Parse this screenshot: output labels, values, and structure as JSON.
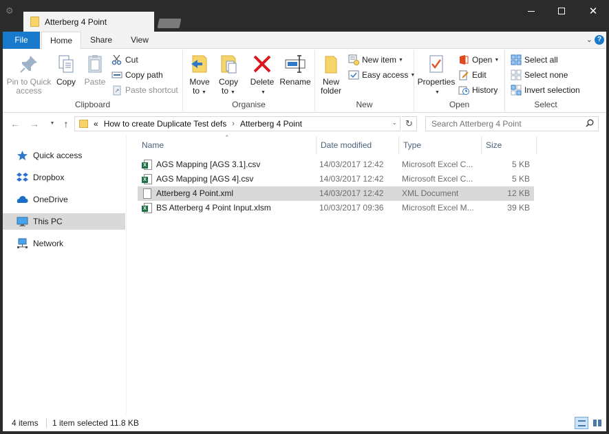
{
  "window": {
    "tab_title": "Atterberg 4 Point"
  },
  "ribbon_tabs": {
    "file": "File",
    "home": "Home",
    "share": "Share",
    "view": "View"
  },
  "ribbon": {
    "clipboard": {
      "label": "Clipboard",
      "pin_line1": "Pin to Quick",
      "pin_line2": "access",
      "copy": "Copy",
      "paste": "Paste",
      "cut": "Cut",
      "copy_path": "Copy path",
      "paste_shortcut": "Paste shortcut"
    },
    "organise": {
      "label": "Organise",
      "move_line1": "Move",
      "move_line2": "to",
      "copy_line1": "Copy",
      "copy_line2": "to",
      "delete": "Delete",
      "rename": "Rename"
    },
    "new": {
      "label": "New",
      "new_folder_line1": "New",
      "new_folder_line2": "folder",
      "new_item": "New item",
      "easy_access": "Easy access"
    },
    "open": {
      "label": "Open",
      "properties": "Properties",
      "open": "Open",
      "edit": "Edit",
      "history": "History"
    },
    "select": {
      "label": "Select",
      "select_all": "Select all",
      "select_none": "Select none",
      "invert_selection": "Invert selection"
    }
  },
  "address": {
    "overflow": "«",
    "crumb1": "How to create Duplicate Test defs",
    "crumb2": "Atterberg 4 Point"
  },
  "search": {
    "placeholder": "Search Atterberg 4 Point"
  },
  "navpane": {
    "items": [
      {
        "label": "Quick access"
      },
      {
        "label": "Dropbox"
      },
      {
        "label": "OneDrive"
      },
      {
        "label": "This PC"
      },
      {
        "label": "Network"
      }
    ]
  },
  "columns": {
    "name": "Name",
    "date": "Date modified",
    "type": "Type",
    "size": "Size"
  },
  "files": [
    {
      "name": "AGS Mapping [AGS 3.1].csv",
      "date": "14/03/2017 12:42",
      "type": "Microsoft Excel C...",
      "size": "5 KB",
      "icon": "excel-icon"
    },
    {
      "name": "AGS Mapping [AGS 4].csv",
      "date": "14/03/2017 12:42",
      "type": "Microsoft Excel C...",
      "size": "5 KB",
      "icon": "excel-icon"
    },
    {
      "name": "Atterberg 4 Point.xml",
      "date": "14/03/2017 12:42",
      "type": "XML Document",
      "size": "12 KB",
      "icon": "document-icon"
    },
    {
      "name": "BS Atterberg 4 Point Input.xlsm",
      "date": "10/03/2017 09:36",
      "type": "Microsoft Excel M...",
      "size": "39 KB",
      "icon": "excel-icon"
    }
  ],
  "status": {
    "count": "4 items",
    "selection": "1 item selected  11.8 KB"
  },
  "colors": {
    "file_tab": "#1979ca",
    "selection": "#d9d9d9",
    "titlebar": "#2b2b2b"
  }
}
